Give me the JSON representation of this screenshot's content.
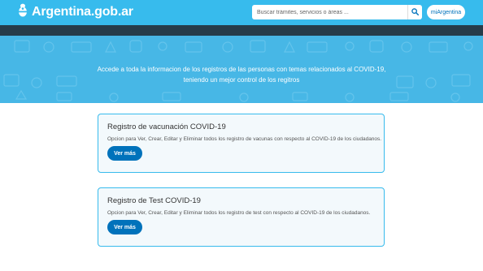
{
  "header": {
    "brand_name": "Argentina.gob.ar",
    "search_placeholder": "Buscar trámites, servicios o áreas ...",
    "account_button": "miArgentina"
  },
  "hero": {
    "line1": "Accede a toda la informacion de los registros de las personas con temas relacionados al COVID-19,",
    "line2": "teniendo un mejor control de los regitros"
  },
  "cards": [
    {
      "title": "Registro de vacunación COVID-19",
      "description": "Opcion para Ver, Crear, Editar y Eliminar todos los registro de vacunas con respecto al COVID-19 de los ciudadanos.",
      "button": "Ver más"
    },
    {
      "title": "Registro de Test COVID-19",
      "description": "Opcion para Ver, Crear, Editar y Eliminar todos los registro de test con respecto al COVID-19 de los ciudadanos.",
      "button": "Ver más"
    }
  ],
  "icons": {
    "brand": "argentina-coat-of-arms-icon",
    "search": "search-icon"
  },
  "colors": {
    "header": "#37bbed",
    "dark_strip": "#263c4a",
    "hero": "#47b7e6",
    "primary_button": "#0072bb",
    "card_border": "#37bbed",
    "card_background": "#f3f9fc"
  }
}
